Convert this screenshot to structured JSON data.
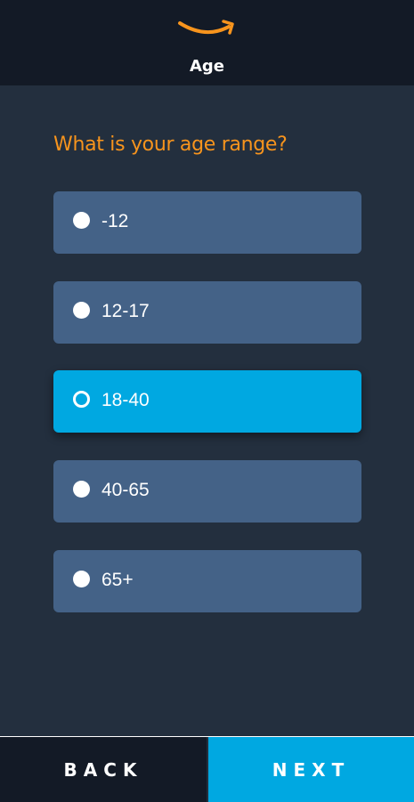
{
  "header": {
    "logo_icon": "amazon-smile-icon",
    "title": "Age"
  },
  "question": "What is your age range?",
  "options": [
    {
      "label": "-12",
      "selected": false
    },
    {
      "label": "12-17",
      "selected": false
    },
    {
      "label": "18-40",
      "selected": true
    },
    {
      "label": "40-65",
      "selected": false
    },
    {
      "label": "65+",
      "selected": false
    }
  ],
  "footer": {
    "back_label": "BACK",
    "next_label": "NEXT"
  },
  "colors": {
    "background": "#232f3e",
    "header": "#131a26",
    "accent_orange": "#f7941d",
    "option": "#446287",
    "selected": "#00a8e1"
  }
}
